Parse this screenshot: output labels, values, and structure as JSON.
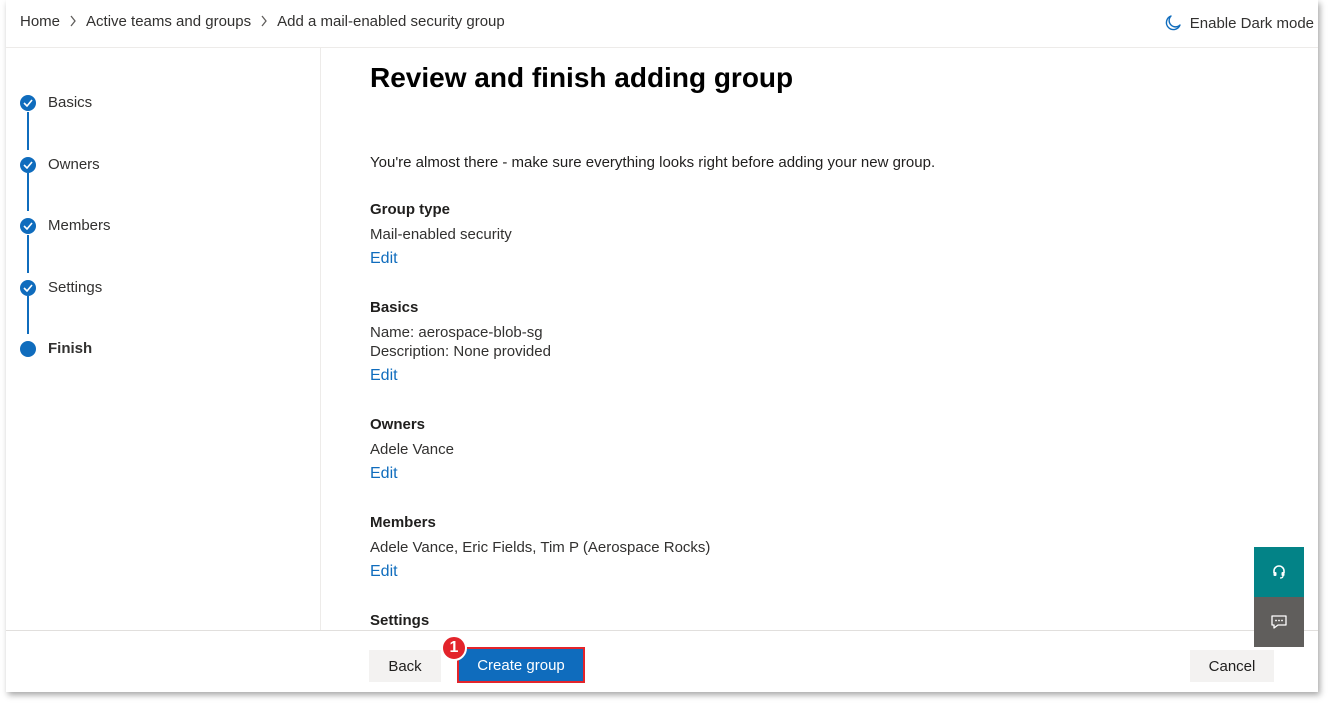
{
  "breadcrumb": {
    "items": [
      "Home",
      "Active teams and groups",
      "Add a mail-enabled security group"
    ]
  },
  "header": {
    "dark_mode_label": "Enable Dark mode",
    "dark_mode_icon": "moon-icon"
  },
  "steps": [
    {
      "label": "Basics",
      "state": "completed"
    },
    {
      "label": "Owners",
      "state": "completed"
    },
    {
      "label": "Members",
      "state": "completed"
    },
    {
      "label": "Settings",
      "state": "completed"
    },
    {
      "label": "Finish",
      "state": "current"
    }
  ],
  "main": {
    "title": "Review and finish adding group",
    "intro": "You're almost there - make sure everything looks right before adding your new group.",
    "sections": [
      {
        "title": "Group type",
        "lines": [
          "Mail-enabled security"
        ],
        "edit_label": "Edit"
      },
      {
        "title": "Basics",
        "lines": [
          "Name: aerospace-blob-sg",
          "Description: None provided"
        ],
        "edit_label": "Edit"
      },
      {
        "title": "Owners",
        "lines": [
          "Adele Vance"
        ],
        "edit_label": "Edit"
      },
      {
        "title": "Members",
        "lines": [
          "Adele Vance, Eric Fields, Tim P (Aerospace Rocks)"
        ],
        "edit_label": "Edit"
      },
      {
        "title": "Settings",
        "lines": [],
        "edit_label": ""
      }
    ]
  },
  "footer": {
    "back_label": "Back",
    "create_label": "Create group",
    "cancel_label": "Cancel",
    "callout_number": "1"
  },
  "floating": {
    "help_icon": "headset-icon",
    "feedback_icon": "chat-feedback-icon"
  },
  "colors": {
    "accent": "#0f6cbd",
    "callout": "#e3242b",
    "help_button": "#038387",
    "feedback_button": "#605e5c"
  }
}
